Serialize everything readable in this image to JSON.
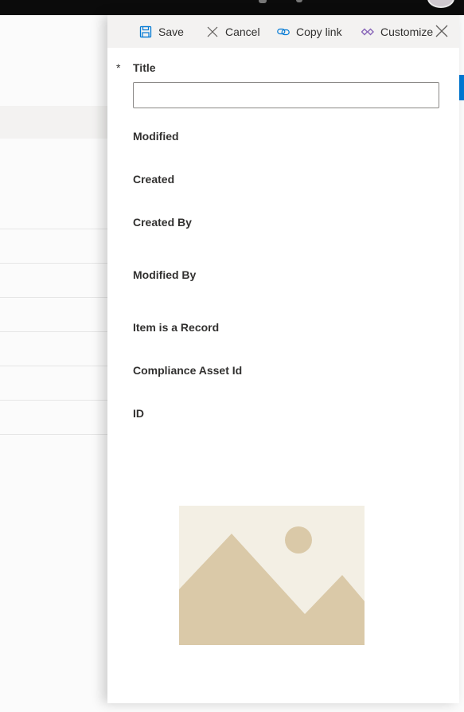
{
  "toolbar": {
    "save_label": "Save",
    "cancel_label": "Cancel",
    "copy_link_label": "Copy link",
    "customize_label": "Customize"
  },
  "form": {
    "required_marker": "*",
    "fields": [
      {
        "label": "Title",
        "value": "",
        "required": true
      },
      {
        "label": "Modified"
      },
      {
        "label": "Created"
      },
      {
        "label": "Created By"
      },
      {
        "label": "Modified By"
      },
      {
        "label": "Item is a Record"
      },
      {
        "label": "Compliance Asset Id"
      },
      {
        "label": "ID"
      }
    ]
  },
  "icons": {
    "save": "save-icon",
    "cancel": "cancel-icon",
    "copy_link": "link-icon",
    "customize": "customize-icon",
    "close": "close-icon",
    "image": "image-placeholder-icon"
  },
  "colors": {
    "accent": "#0078d4",
    "customize": "#8764b8",
    "image_bg": "#f3efe4",
    "image_fg": "#dac9a8"
  }
}
